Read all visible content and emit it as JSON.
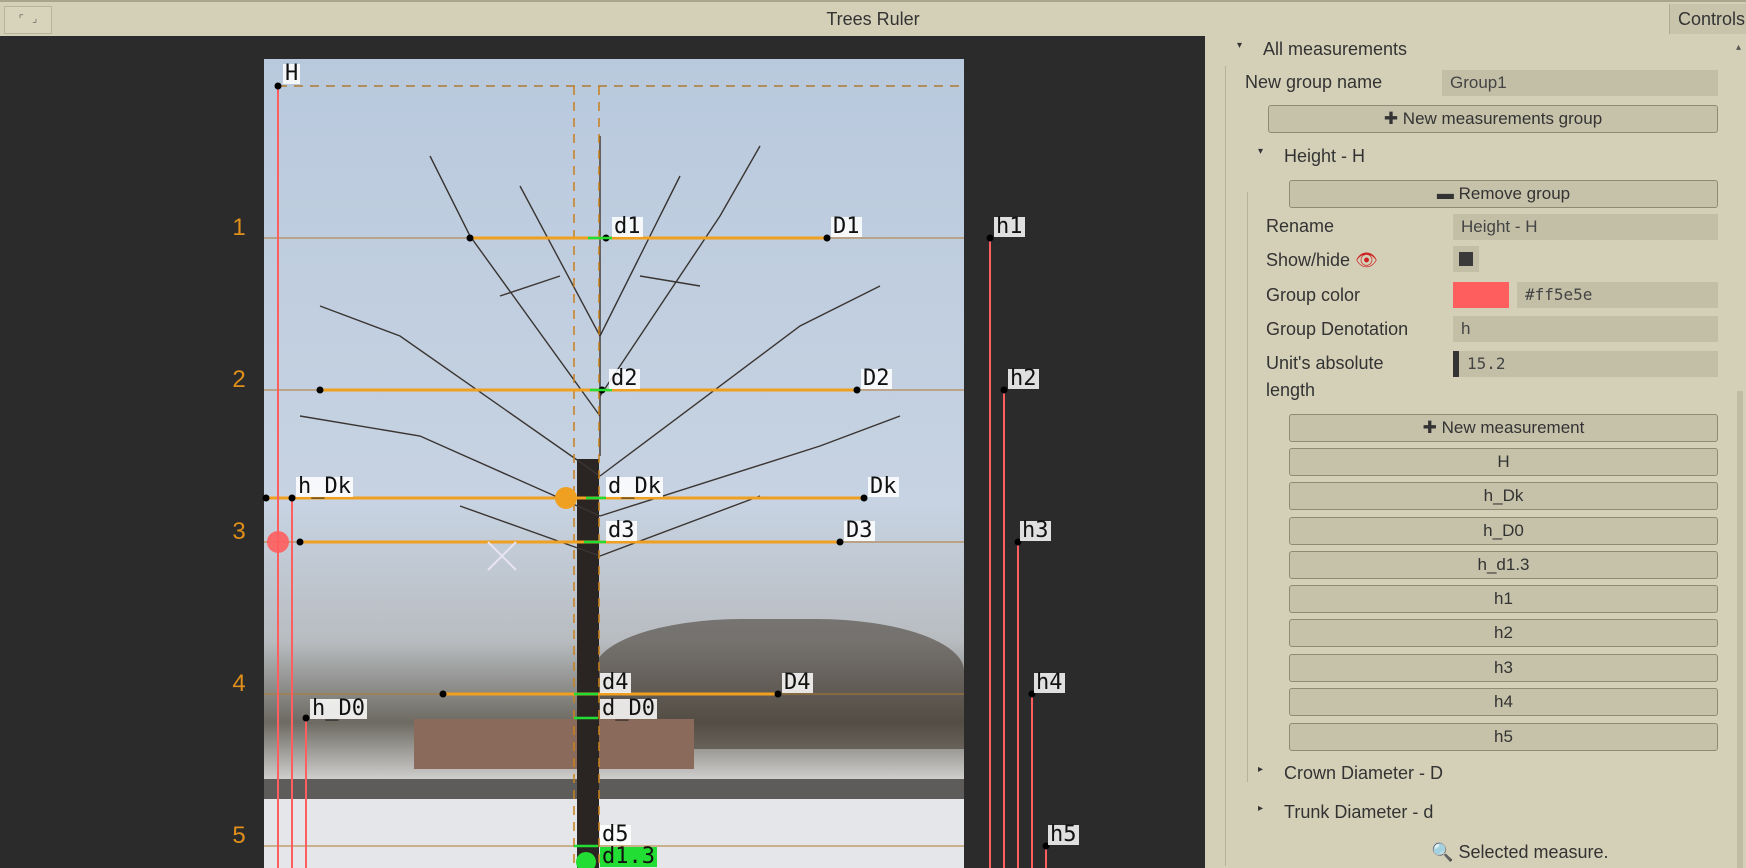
{
  "window": {
    "title": "Trees Ruler",
    "corner_button_glyph": "⌜ ⌟",
    "controls_tab": "Controls"
  },
  "viewer": {
    "scale_marks": [
      "1",
      "2",
      "3",
      "4",
      "5"
    ],
    "labels": {
      "H": "H",
      "d1": "d1",
      "D1": "D1",
      "h1": "h1",
      "d2": "d2",
      "D2": "D2",
      "h2": "h2",
      "h_Dk": "h_Dk",
      "d_Dk": "d_Dk",
      "Dk": "Dk",
      "d3": "d3",
      "D3": "D3",
      "h3": "h3",
      "d4": "d4",
      "D4": "D4",
      "h4": "h4",
      "d_D0": "d_D0",
      "h_D0": "h_D0",
      "d5": "d5",
      "h5": "h5",
      "d1_3": "d1.3"
    },
    "colors": {
      "height_group": "#ff5e5e",
      "crown_lines": "#f0a020",
      "trunk_handles": "#22dd33"
    }
  },
  "panel": {
    "all_measurements": "All measurements",
    "new_group_name_label": "New group name",
    "new_group_name_value": "Group1",
    "new_group_button": "New measurements group",
    "group": {
      "title": "Height - H",
      "remove_button": "Remove group",
      "rename_label": "Rename",
      "rename_value": "Height - H",
      "show_hide_label": "Show/hide",
      "color_label": "Group color",
      "color_hex": "#ff5e5e",
      "denotation_label": "Group Denotation",
      "denotation_value": "h",
      "unit_label_line1": "Unit's absolute",
      "unit_label_line2": "length",
      "unit_value": "15.2",
      "new_measurement_button": "New measurement",
      "measurements": [
        "H",
        "h_Dk",
        "h_D0",
        "h_d1.3",
        "h1",
        "h2",
        "h3",
        "h4",
        "h5"
      ]
    },
    "crown_group": "Crown Diameter - D",
    "trunk_group": "Trunk Diameter - d",
    "selected_measure": "Selected measure."
  }
}
